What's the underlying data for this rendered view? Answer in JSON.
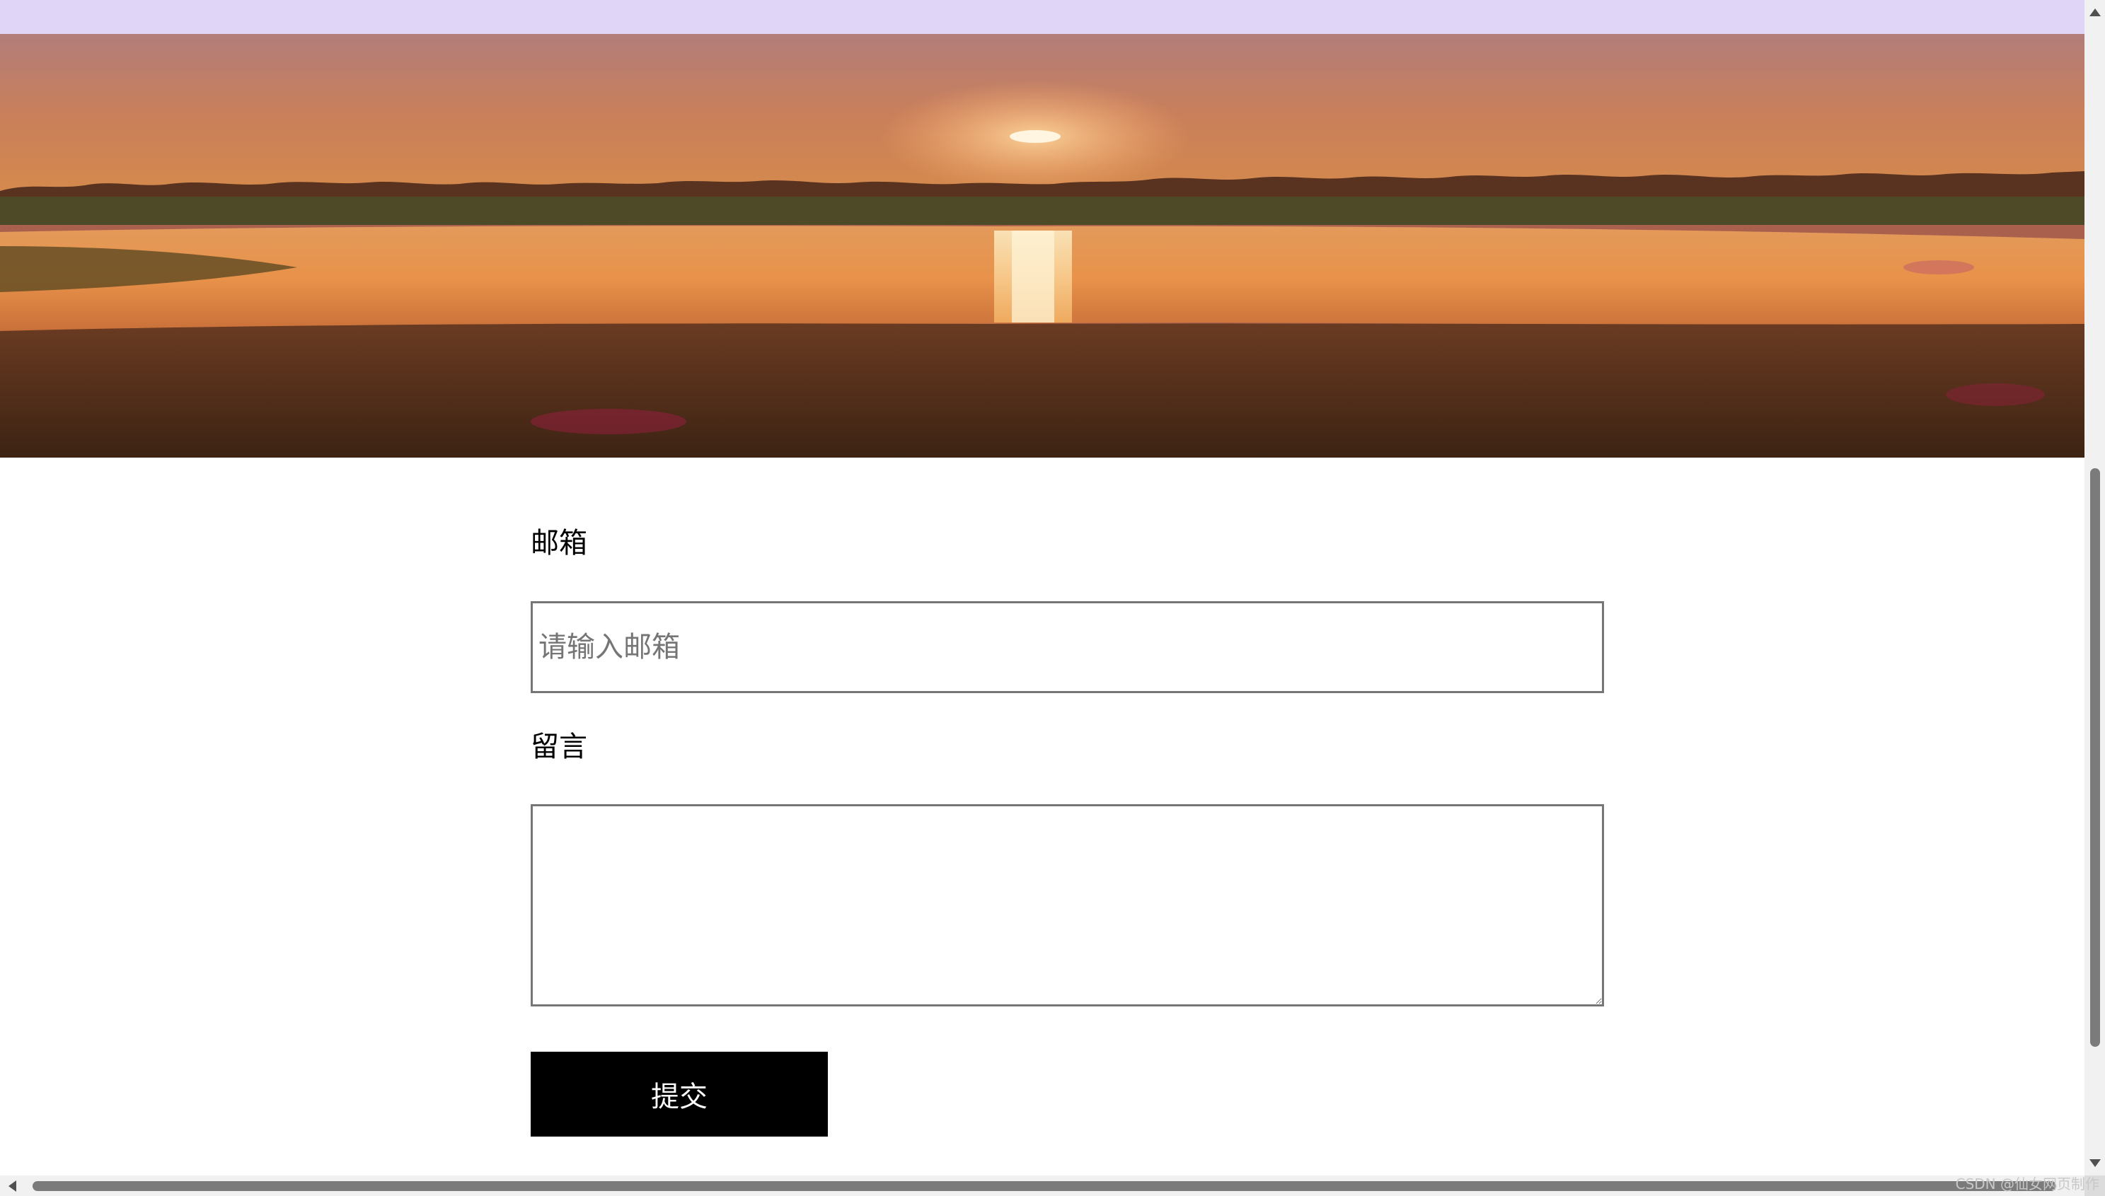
{
  "form": {
    "email_label": "邮箱",
    "email_placeholder": "请输入邮箱",
    "email_value": "",
    "message_label": "留言",
    "message_value": "",
    "submit_label": "提交"
  },
  "watermark": "CSDN @仙女网页制作",
  "colors": {
    "top_strip": "#e1d5f7",
    "button_bg": "#000000",
    "button_text": "#ffffff"
  },
  "hero": {
    "image": "sunset-lake-landscape"
  }
}
